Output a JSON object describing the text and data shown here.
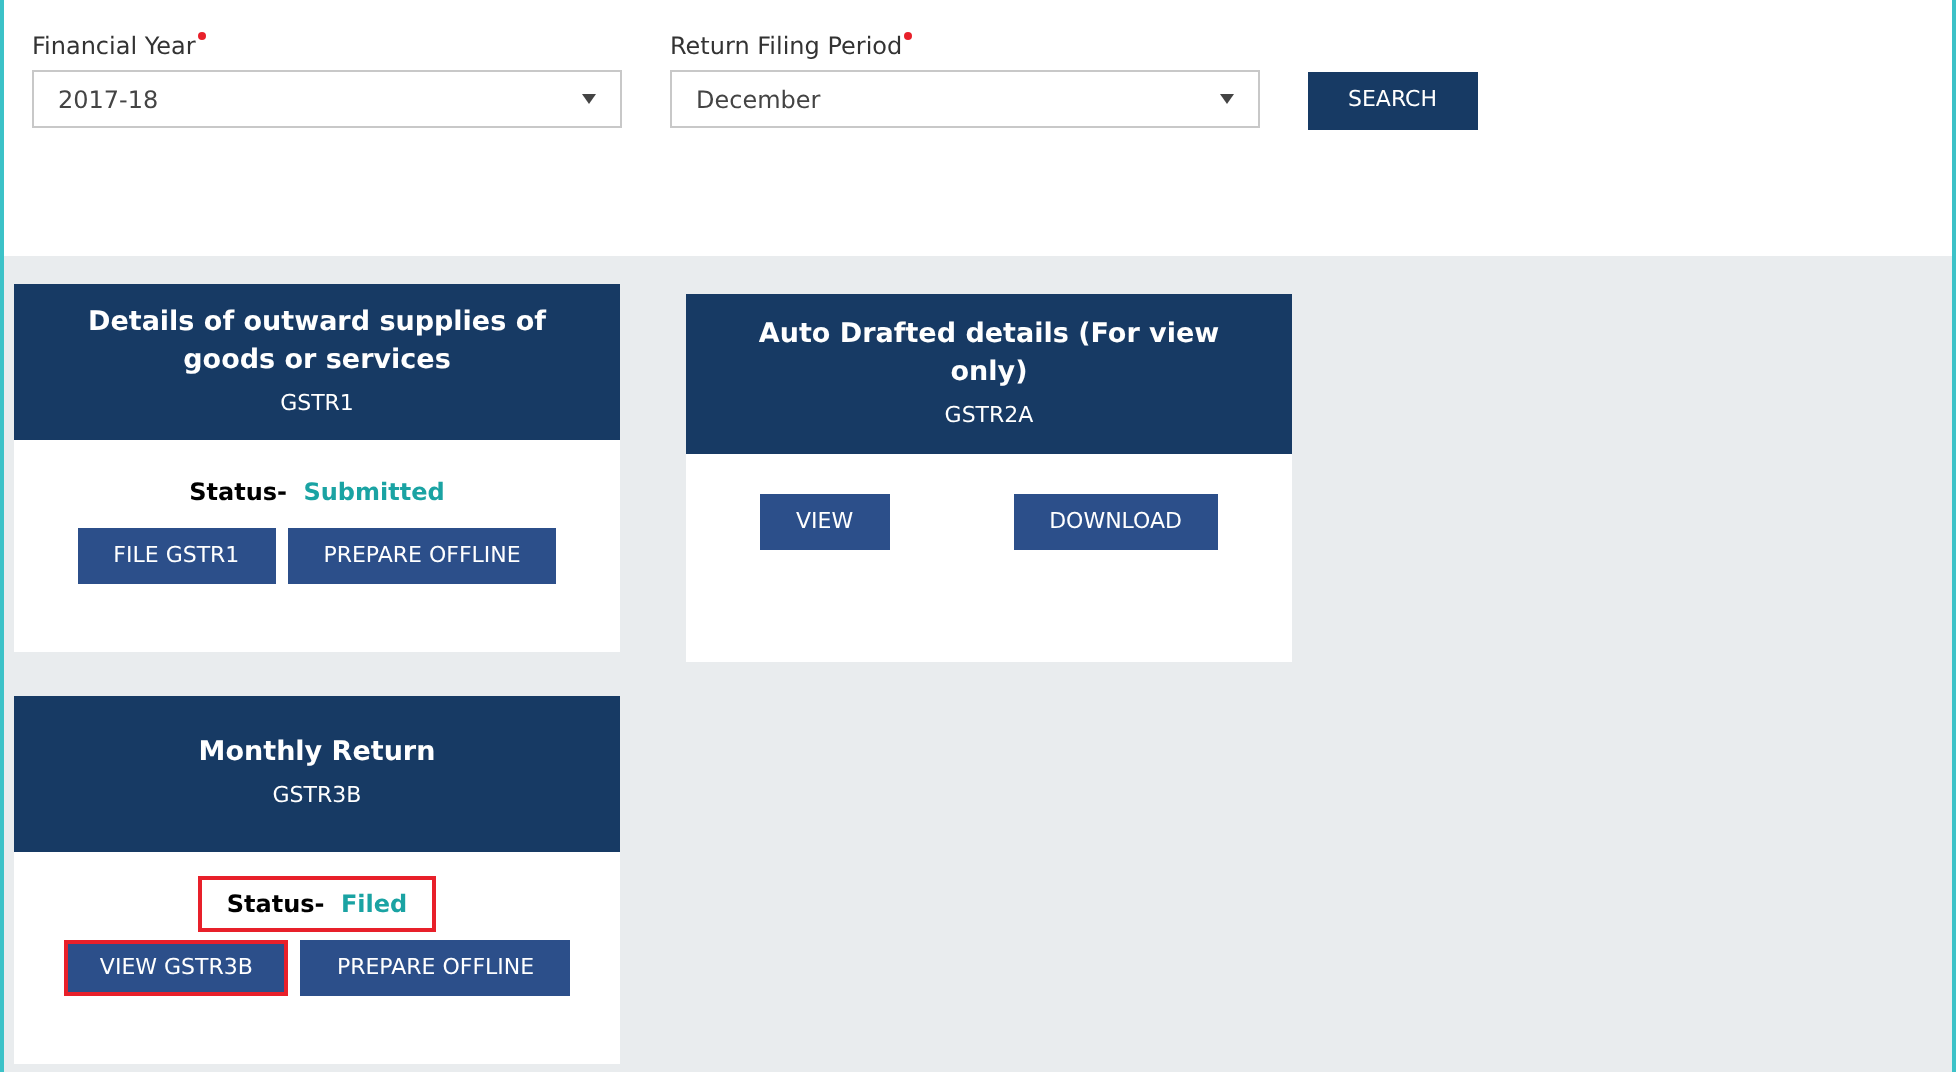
{
  "filters": [
    {
      "label": "Financial Year",
      "required": true,
      "value": "2017-18"
    },
    {
      "label": "Return Filing Period",
      "required": true,
      "value": "December"
    }
  ],
  "search_button": "SEARCH",
  "columns": [
    {
      "cards": [
        {
          "title": "Details of outward supplies of goods or services",
          "code": "GSTR1",
          "status": {
            "label": "Status-",
            "value": "Submitted",
            "highlighted": false
          },
          "buttons": [
            {
              "label": "FILE GSTR1",
              "highlighted": false
            },
            {
              "label": "PREPARE OFFLINE",
              "highlighted": false
            }
          ]
        },
        {
          "title": "Monthly Return",
          "code": "GSTR3B",
          "status": {
            "label": "Status-",
            "value": "Filed",
            "highlighted": true
          },
          "buttons": [
            {
              "label": "VIEW GSTR3B",
              "highlighted": true
            },
            {
              "label": "PREPARE OFFLINE",
              "highlighted": false
            }
          ]
        }
      ]
    },
    {
      "cards": [
        {
          "title": "Auto Drafted details (For view only)",
          "code": "GSTR2A",
          "buttons": [
            {
              "label": "VIEW",
              "highlighted": false
            },
            {
              "label": "DOWNLOAD",
              "highlighted": false
            }
          ]
        }
      ]
    }
  ]
}
